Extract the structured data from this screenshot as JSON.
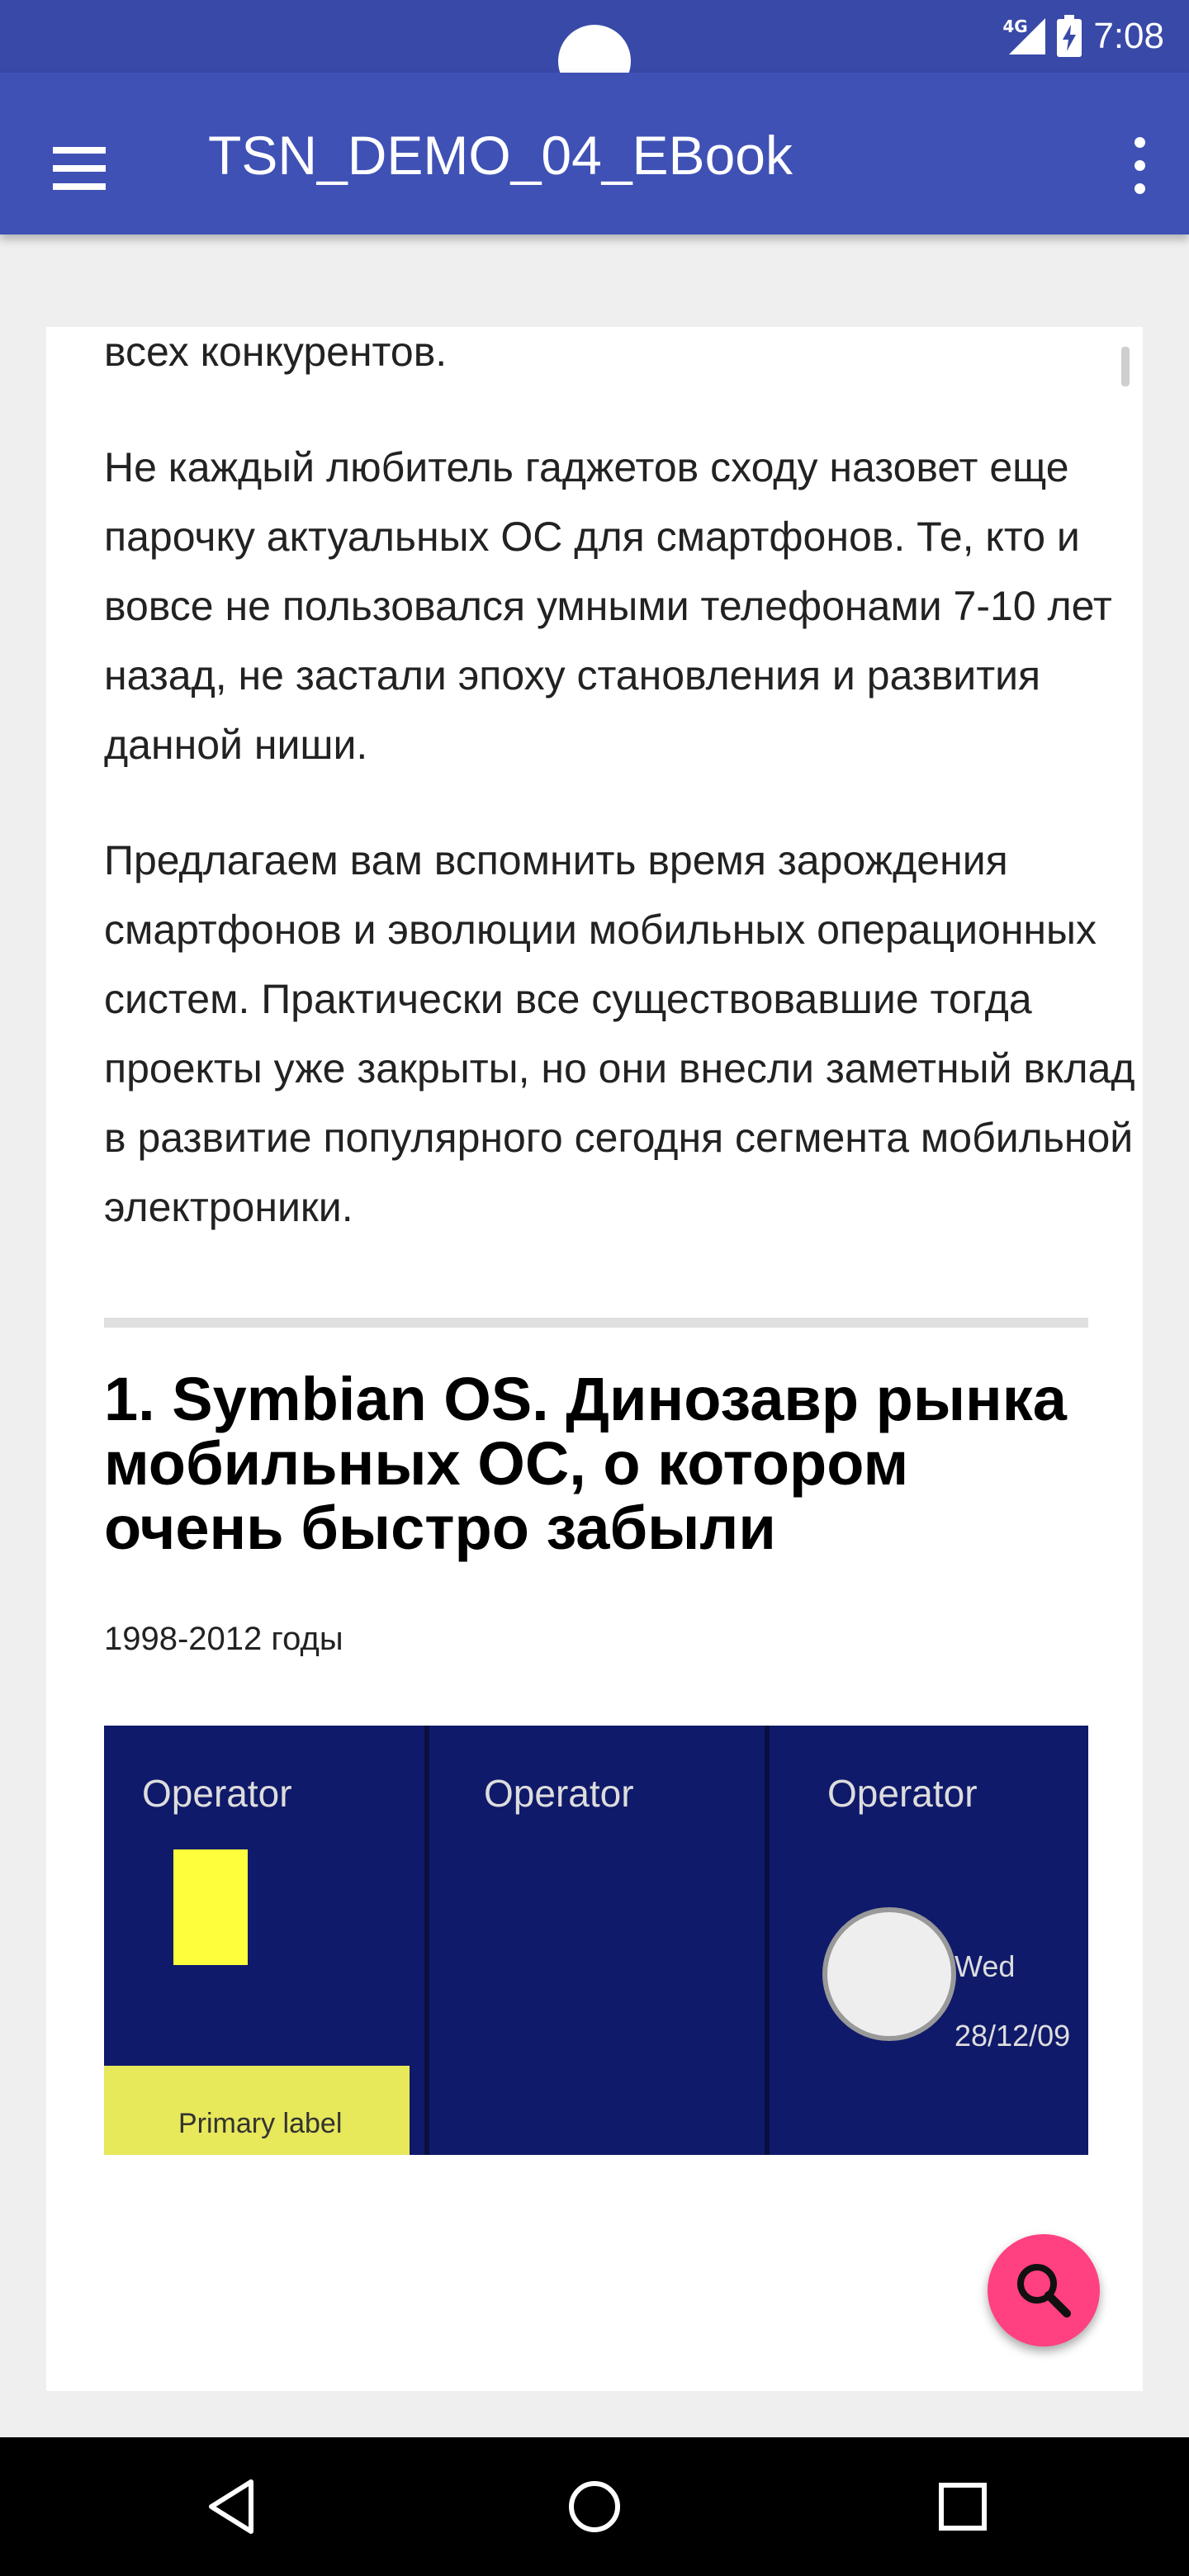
{
  "status_bar": {
    "time": "7:08",
    "network": "4G",
    "icons": [
      "signal-icon",
      "battery-charging-icon"
    ]
  },
  "app_bar": {
    "title": "TSN_DEMO_04_EBook",
    "icons": [
      "menu-icon",
      "more-vert-icon"
    ]
  },
  "article": {
    "paragraphs": [
      "всех конкурентов.",
      "Не каждый любитель гаджетов сходу назовет еще парочку актуальных ОС для смартфонов. Те, кто и вовсе не пользовался умными телефонами 7-10 лет назад, не застали эпоху становления и развития данной ниши.",
      "Предлагаем вам вспомнить время зарождения смартфонов и эволюции мобильных операционных систем. Практически все существовавшие тогда проекты уже закрыты, но они внесли заметный вклад в развитие популярного сегодня сегмента мобильной электроники."
    ],
    "section_heading": "1. Symbian OS. Динозавр рынка мобильных ОС, о котором очень быстро забыли",
    "section_dates": "1998-2012 годы",
    "image": {
      "operator_label": "Operator",
      "primary_label": "Primary label",
      "clock_date": "Wed 28/12/09"
    }
  },
  "fab": {
    "icon": "search-icon"
  },
  "nav_bar": {
    "icons": [
      "back-icon",
      "home-icon",
      "recents-icon"
    ]
  },
  "colors": {
    "app_bar": "#3f51b5",
    "status_bar": "#3849a8",
    "fab": "#ff4081"
  }
}
